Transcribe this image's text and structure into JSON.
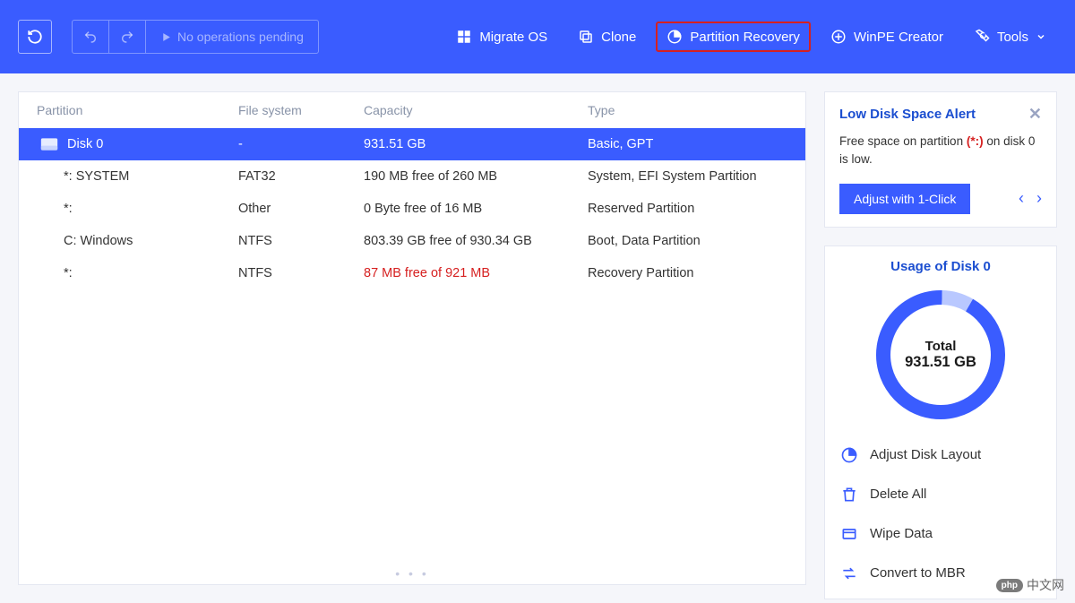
{
  "toolbar": {
    "no_ops_label": "No operations pending",
    "migrate_label": "Migrate OS",
    "clone_label": "Clone",
    "partition_recovery_label": "Partition Recovery",
    "winpe_label": "WinPE Creator",
    "tools_label": "Tools"
  },
  "table": {
    "headers": {
      "partition": "Partition",
      "fs": "File system",
      "capacity": "Capacity",
      "type": "Type"
    },
    "disk_row": {
      "name": "Disk 0",
      "fs": "-",
      "capacity": "931.51 GB",
      "type": "Basic, GPT"
    },
    "rows": [
      {
        "name": "*: SYSTEM",
        "fs": "FAT32",
        "capacity": "190 MB free of 260 MB",
        "type": "System, EFI System Partition",
        "low": false
      },
      {
        "name": "*:",
        "fs": "Other",
        "capacity": "0 Byte free of 16 MB",
        "type": "Reserved Partition",
        "low": false
      },
      {
        "name": "C: Windows",
        "fs": "NTFS",
        "capacity": "803.39 GB free of 930.34 GB",
        "type": "Boot, Data Partition",
        "low": false
      },
      {
        "name": "*:",
        "fs": "NTFS",
        "capacity": "87 MB free of 921 MB",
        "type": "Recovery Partition",
        "low": true
      }
    ]
  },
  "alert": {
    "title": "Low Disk Space Alert",
    "body_prefix": "Free space on partition ",
    "body_highlight": "(*:)",
    "body_suffix": " on disk 0 is low.",
    "adjust_label": "Adjust with 1-Click"
  },
  "usage": {
    "title": "Usage of Disk 0",
    "total_label": "Total",
    "total_value": "931.51 GB"
  },
  "actions": {
    "adjust_layout": "Adjust Disk Layout",
    "delete_all": "Delete All",
    "wipe_data": "Wipe Data",
    "convert_mbr": "Convert to MBR"
  },
  "watermark": {
    "php": "php",
    "text": "中文网"
  },
  "chart_data": {
    "type": "pie",
    "title": "Usage of Disk 0",
    "total": "931.51 GB",
    "series": [
      {
        "name": "Used arc (light)",
        "value_pct": 8
      },
      {
        "name": "Free arc (ring)",
        "value_pct": 92
      }
    ]
  }
}
